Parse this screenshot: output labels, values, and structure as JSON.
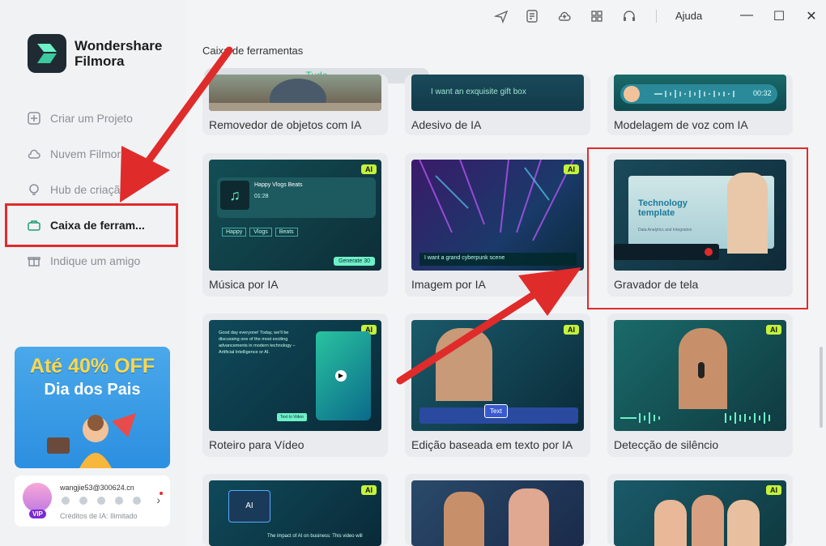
{
  "app": {
    "brand_line1": "Wondershare",
    "brand_line2": "Filmora"
  },
  "topbar": {
    "help": "Ajuda"
  },
  "sidebar": {
    "items": [
      {
        "label": "Criar um Projeto",
        "icon": "plus-square-icon"
      },
      {
        "label": "Nuvem Filmora",
        "icon": "cloud-icon"
      },
      {
        "label": "Hub de criação",
        "icon": "bulb-icon"
      },
      {
        "label": "Caixa de ferram...",
        "icon": "toolbox-icon",
        "active": true
      },
      {
        "label": "Indique um amigo",
        "icon": "gift-icon"
      }
    ],
    "promo": {
      "title": "Até 40% OFF",
      "subtitle": "Dia dos Pais"
    },
    "account": {
      "email": "wangjie53@300624.cn",
      "vip": "VIP",
      "credits": "Créditos de IA: Ilimitado"
    }
  },
  "main": {
    "title": "Caixa de ferramentas",
    "filter": "Tudo",
    "cards": [
      {
        "label": "Removedor de objetos com IA",
        "thumb_text": ""
      },
      {
        "label": "Adesivo de IA",
        "thumb_text": "I want an exquisite gift box"
      },
      {
        "label": "Modelagem de voz com IA",
        "thumb_text": "00:32"
      },
      {
        "label": "Música por IA",
        "thumb_text": "Happy Vlogs Beats",
        "thumb_tags": [
          "Happy",
          "Vlogs",
          "Beats"
        ],
        "thumb_time": "01:28",
        "thumb_button": "Generate 30"
      },
      {
        "label": "Imagem por IA",
        "thumb_text": "I want a grand cyberpunk scene"
      },
      {
        "label": "Gravador de tela",
        "thumb_text": "Technology template",
        "thumb_sub": "Data Analytics and Integration"
      },
      {
        "label": "Roteiro para Vídeo",
        "thumb_text": "Good day everyone! Today, we'll be discussing one of the most exciting advancements in modern technology – Artificial Intelligence or AI.",
        "thumb_button": "Text to Video"
      },
      {
        "label": "Edição baseada em texto por IA",
        "thumb_text": "Text"
      },
      {
        "label": "Detecção de silêncio",
        "thumb_text": ""
      },
      {
        "label": "",
        "thumb_text": "The impact of AI on business: This video will"
      },
      {
        "label": "",
        "thumb_text": ""
      },
      {
        "label": "",
        "thumb_text": ""
      }
    ],
    "ai_badge": "AI"
  }
}
